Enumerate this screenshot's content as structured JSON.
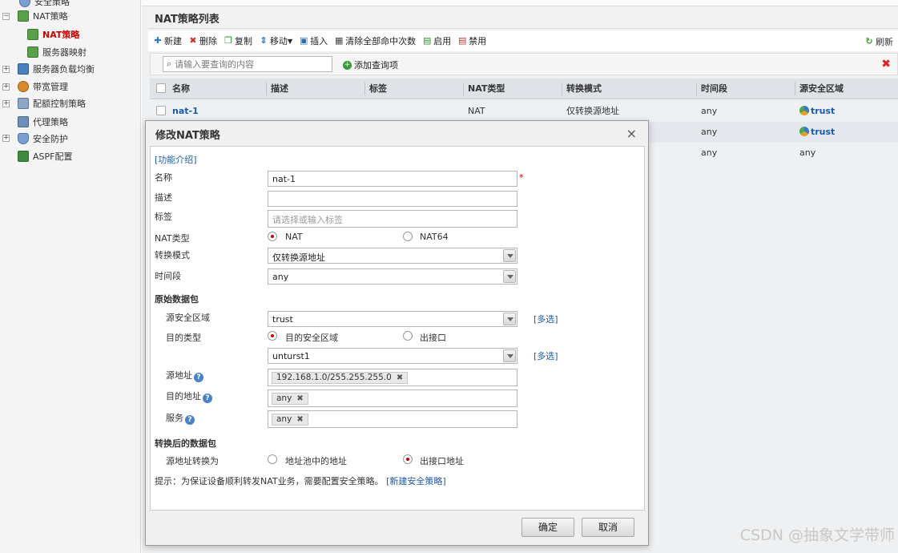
{
  "sidebar": {
    "items": [
      {
        "label": "安全策略"
      },
      {
        "label": "NAT策略"
      },
      {
        "label": "NAT策略"
      },
      {
        "label": "服务器映射"
      },
      {
        "label": "服务器负载均衡"
      },
      {
        "label": "带宽管理"
      },
      {
        "label": "配额控制策略"
      },
      {
        "label": "代理策略"
      },
      {
        "label": "安全防护"
      },
      {
        "label": "ASPF配置"
      }
    ]
  },
  "main": {
    "title": "NAT策略列表",
    "toolbar": {
      "new": "新建",
      "delete": "删除",
      "copy": "复制",
      "move": "移动",
      "insert": "插入",
      "clear_hits": "清除全部命中次数",
      "enable": "启用",
      "disable": "禁用",
      "refresh": "刷新"
    },
    "search": {
      "placeholder": "请输入要查询的内容",
      "add_query": "添加查询项"
    },
    "columns": [
      "名称",
      "描述",
      "标签",
      "NAT类型",
      "转换模式",
      "时间段",
      "源安全区域"
    ],
    "rows": [
      {
        "name": "nat-1",
        "nat_type": "NAT",
        "mode": "仅转换源地址",
        "time": "any",
        "zone": "trust"
      },
      {
        "time": "any",
        "zone": "trust"
      },
      {
        "time": "any",
        "zone": "any"
      }
    ]
  },
  "modal": {
    "title": "修改NAT策略",
    "intro_link": "[功能介绍]",
    "labels": {
      "name": "名称",
      "desc": "描述",
      "tag": "标签",
      "nat_type": "NAT类型",
      "mode": "转换模式",
      "time": "时间段",
      "orig_packet": "原始数据包",
      "src_zone": "源安全区域",
      "dst_type": "目的类型",
      "src_addr": "源地址",
      "dst_addr": "目的地址",
      "service": "服务",
      "after_packet": "转换后的数据包",
      "src_translate": "源地址转换为"
    },
    "values": {
      "name": "nat-1",
      "desc": "",
      "tag_placeholder": "请选择或输入标签",
      "mode": "仅转换源地址",
      "time": "any",
      "src_zone": "trust",
      "dst_zone": "unturst1",
      "src_addr_tag": "192.168.1.0/255.255.255.0",
      "dst_addr_tag": "any",
      "service_tag": "any"
    },
    "options": {
      "nat": "NAT",
      "nat64": "NAT64",
      "dst_zone": "目的安全区域",
      "out_iface": "出接口",
      "pool_addr": "地址池中的地址",
      "out_iface_addr": "出接口地址"
    },
    "multi_select": "[多选]",
    "hint": "提示：为保证设备顺利转发NAT业务，需要配置安全策略。",
    "hint_link": "[新建安全策略]",
    "ok": "确定",
    "cancel": "取消"
  },
  "watermark": "CSDN @抽象文学带师"
}
